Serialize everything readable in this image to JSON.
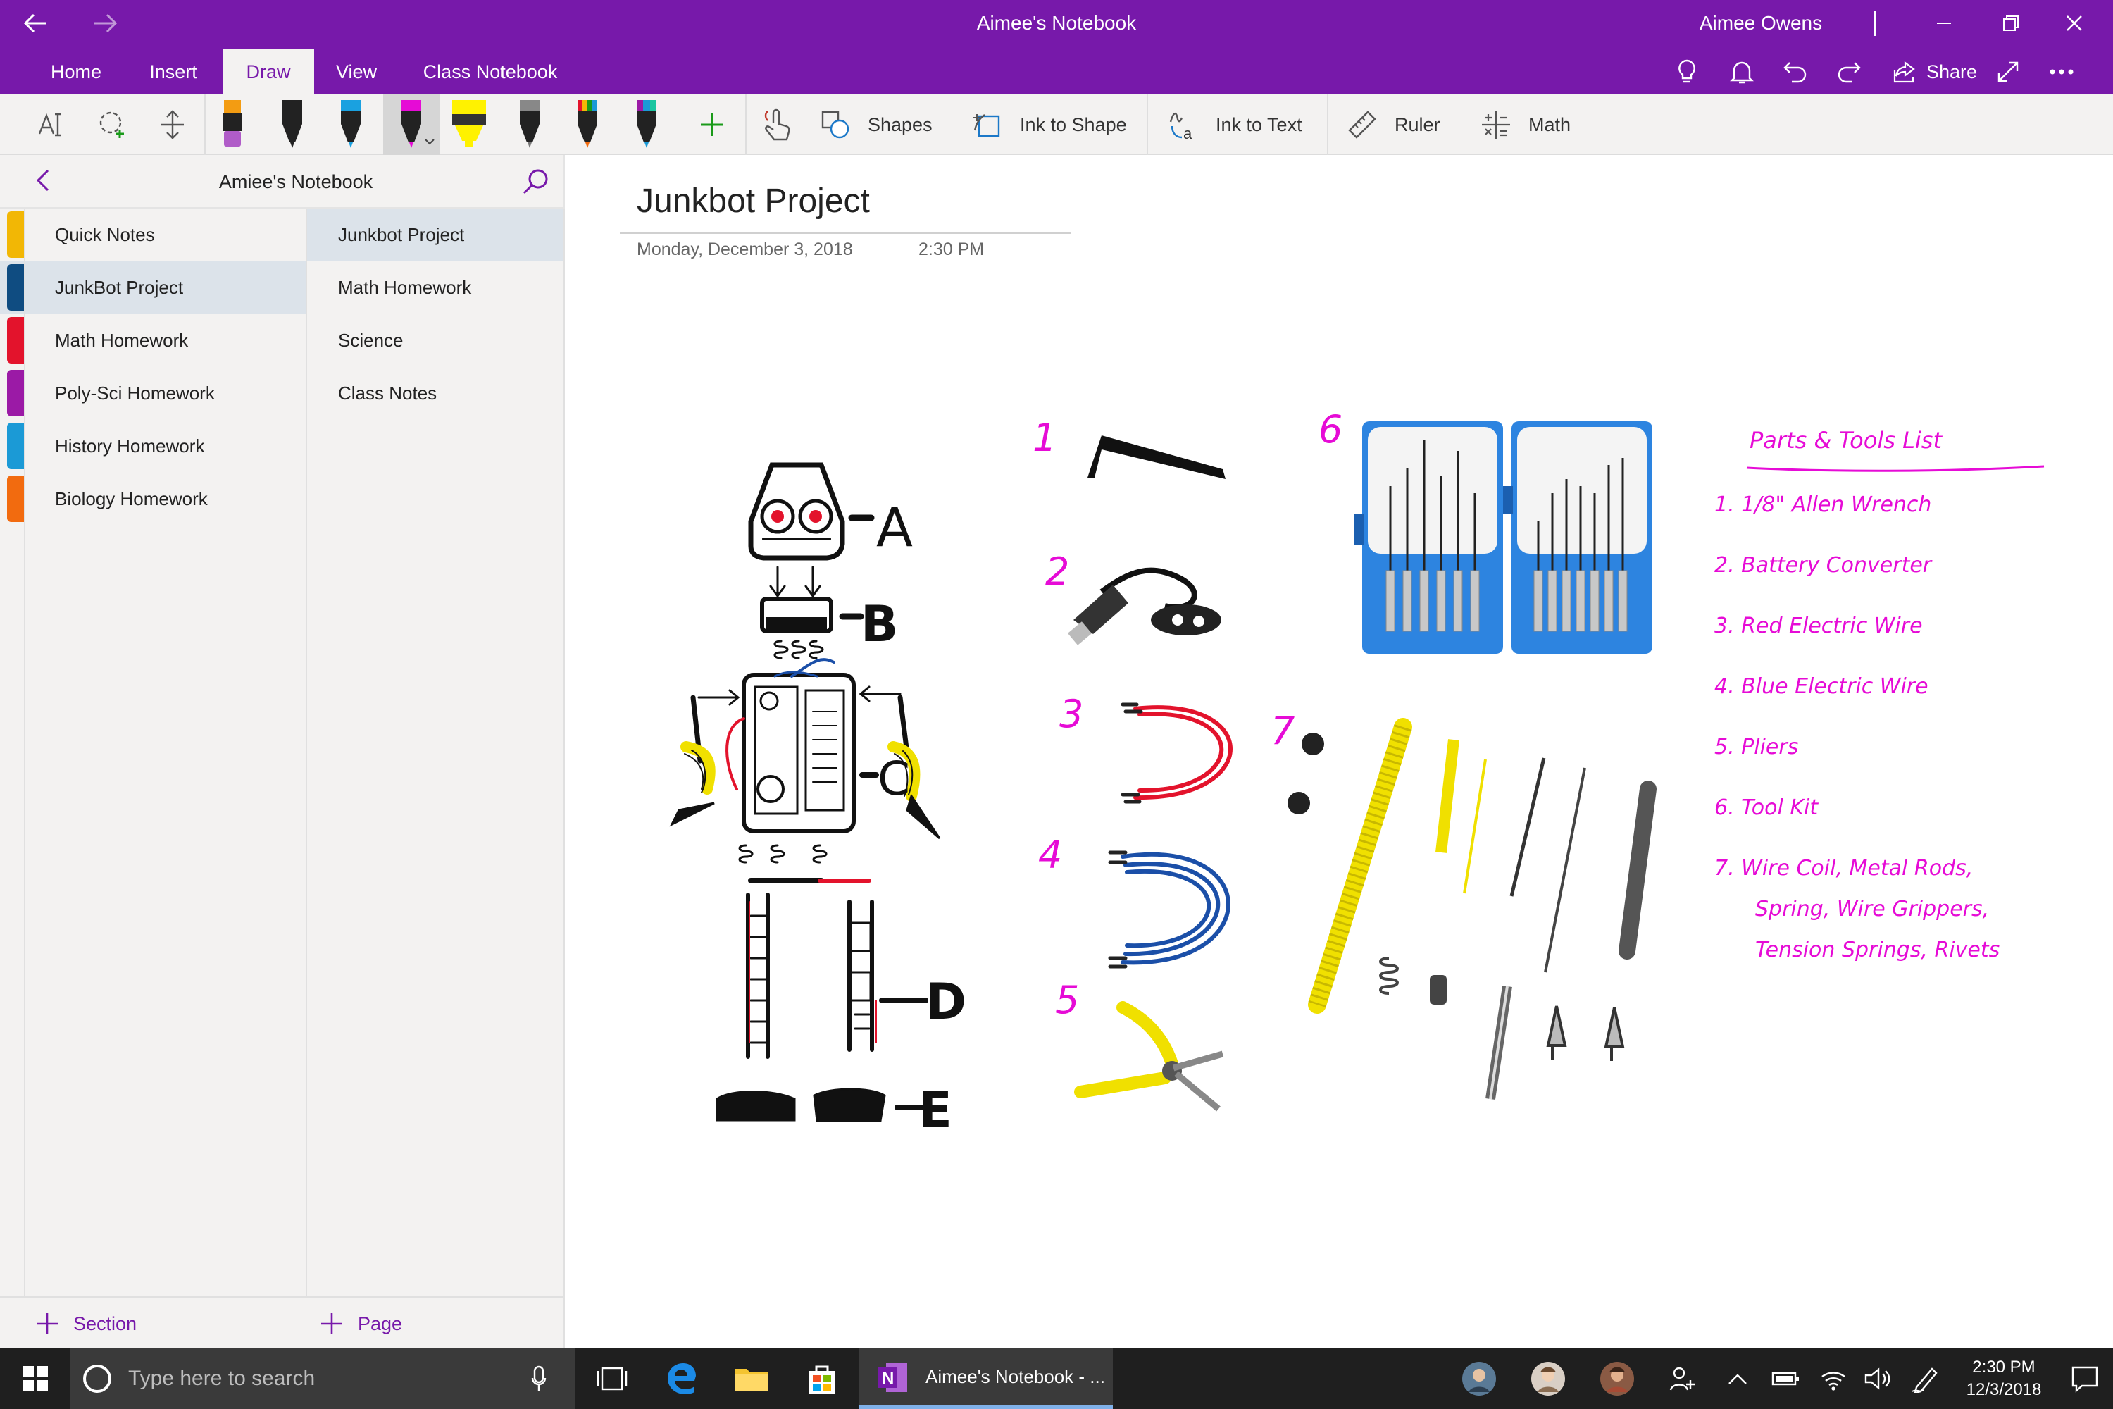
{
  "window": {
    "title": "Aimee's Notebook",
    "user": "Aimee Owens",
    "share_label": "Share"
  },
  "colors": {
    "accent": "#7719aa",
    "ink_pink": "#e60bd6",
    "section_yellow": "#f2b705",
    "section_navy": "#0f4c81",
    "section_red": "#e3132c",
    "section_purple": "#9b1aa6",
    "section_teal": "#1b9ad6",
    "section_orange": "#f26b0f"
  },
  "menu_tabs": [
    {
      "label": "Home"
    },
    {
      "label": "Insert"
    },
    {
      "label": "Draw"
    },
    {
      "label": "View"
    },
    {
      "label": "Class Notebook"
    }
  ],
  "ribbon": {
    "shapes": "Shapes",
    "ink_to_shape": "Ink to Shape",
    "ink_to_text": "Ink to Text",
    "ruler": "Ruler",
    "math": "Math"
  },
  "nav": {
    "notebook_name": "Amiee's Notebook",
    "add_section": "Section",
    "add_page": "Page",
    "sections": [
      {
        "label": "Quick Notes",
        "color": "#f2b705"
      },
      {
        "label": "JunkBot Project",
        "color": "#0f4c81"
      },
      {
        "label": "Math Homework",
        "color": "#e3132c"
      },
      {
        "label": "Poly-Sci Homework",
        "color": "#9b1aa6"
      },
      {
        "label": "History Homework",
        "color": "#1b9ad6"
      },
      {
        "label": "Biology Homework",
        "color": "#f26b0f"
      }
    ],
    "pages": [
      {
        "label": "Junkbot Project"
      },
      {
        "label": "Math Homework"
      },
      {
        "label": "Science"
      },
      {
        "label": "Class Notes"
      }
    ]
  },
  "page": {
    "title": "Junkbot Project",
    "date": "Monday, December 3, 2018",
    "time": "2:30 PM",
    "robot_labels": [
      "A",
      "B",
      "C",
      "D",
      "E"
    ],
    "part_numbers": [
      "1",
      "2",
      "3",
      "4",
      "5",
      "6",
      "7"
    ],
    "list_heading": "Parts & Tools List",
    "list_items": [
      "1. 1/8\" Allen Wrench",
      "2. Battery Converter",
      "3. Red Electric Wire",
      "4. Blue Electric Wire",
      "5. Pliers",
      "6. Tool Kit",
      "7. Wire Coil, Metal Rods,",
      "Spring, Wire Grippers,",
      "Tension Springs, Rivets"
    ]
  },
  "taskbar": {
    "search_placeholder": "Type here to search",
    "app_label": "Aimee's Notebook - ...",
    "clock_time": "2:30 PM",
    "clock_date": "12/3/2018"
  }
}
